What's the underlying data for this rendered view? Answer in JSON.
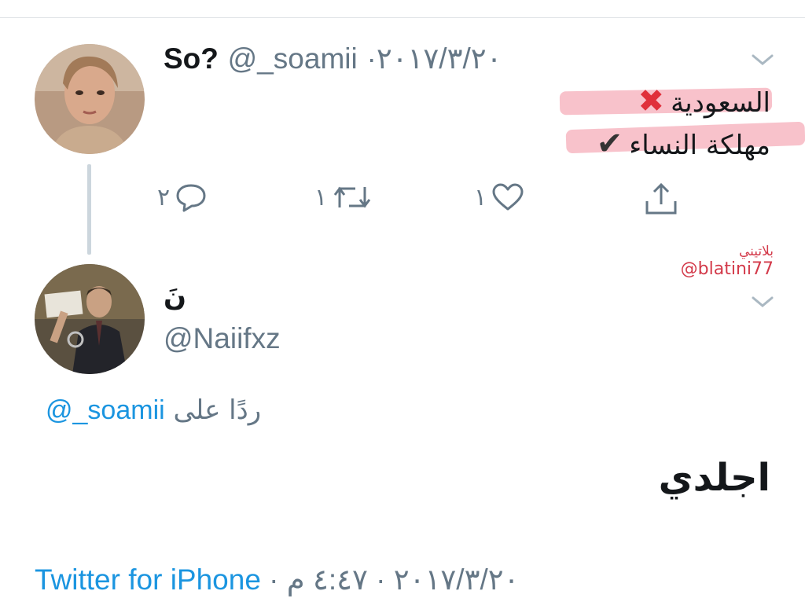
{
  "tweet1": {
    "name": "So?",
    "handle": "@_soamii",
    "separator": "·",
    "date": "٢٠١٧/٣/٢٠",
    "line1": "السعودية",
    "line2": "مهلكة النساء",
    "mark1": "✖",
    "mark2": "✔",
    "reply_count": "٢",
    "retweet_count": "١",
    "like_count": "١"
  },
  "watermark": {
    "name": "بلاتيني",
    "handle": "@blatini77"
  },
  "tweet2": {
    "name": "نَ",
    "handle": "@Naiifxz",
    "replying_prefix": "ردًا على",
    "replying_handle": "@_soamii",
    "text": "اجلدي",
    "source": "Twitter for iPhone",
    "sep": " · ",
    "date": "٢٠١٧/٣/٢٠",
    "time": "٤:٤٧ م"
  },
  "colors": {
    "link": "#1b95e0",
    "muted": "#657786",
    "x_mark": "#e0303b",
    "highlight": "#f0788c"
  },
  "icons": [
    "chevron-down-icon",
    "reply-icon",
    "retweet-icon",
    "like-icon",
    "share-icon"
  ]
}
